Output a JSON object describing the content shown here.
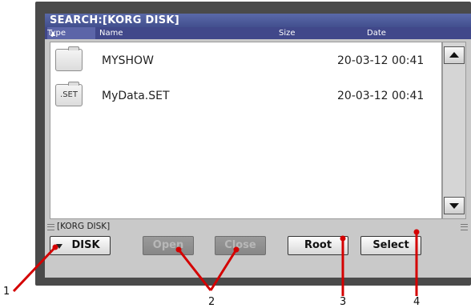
{
  "window": {
    "title": "SEARCH:[KORG DISK]"
  },
  "columns": {
    "type": "Type",
    "name": "Name",
    "size": "Size",
    "date": "Date"
  },
  "files": [
    {
      "icon": "folder-icon",
      "icon_label": "",
      "name": "MYSHOW",
      "date": "20-03-12 00:41"
    },
    {
      "icon": "set-file-icon",
      "icon_label": ".SET",
      "name": "MyData.SET",
      "date": "20-03-12 00:41"
    }
  ],
  "path": "[KORG DISK]",
  "buttons": {
    "disk": "DISK",
    "open": "Open",
    "close": "Close",
    "root": "Root",
    "select": "Select"
  },
  "callouts": [
    "1",
    "2",
    "3",
    "4"
  ],
  "colors": {
    "title_bar": "#4b589a",
    "header_row": "#41488a",
    "callout": "#d40000"
  }
}
